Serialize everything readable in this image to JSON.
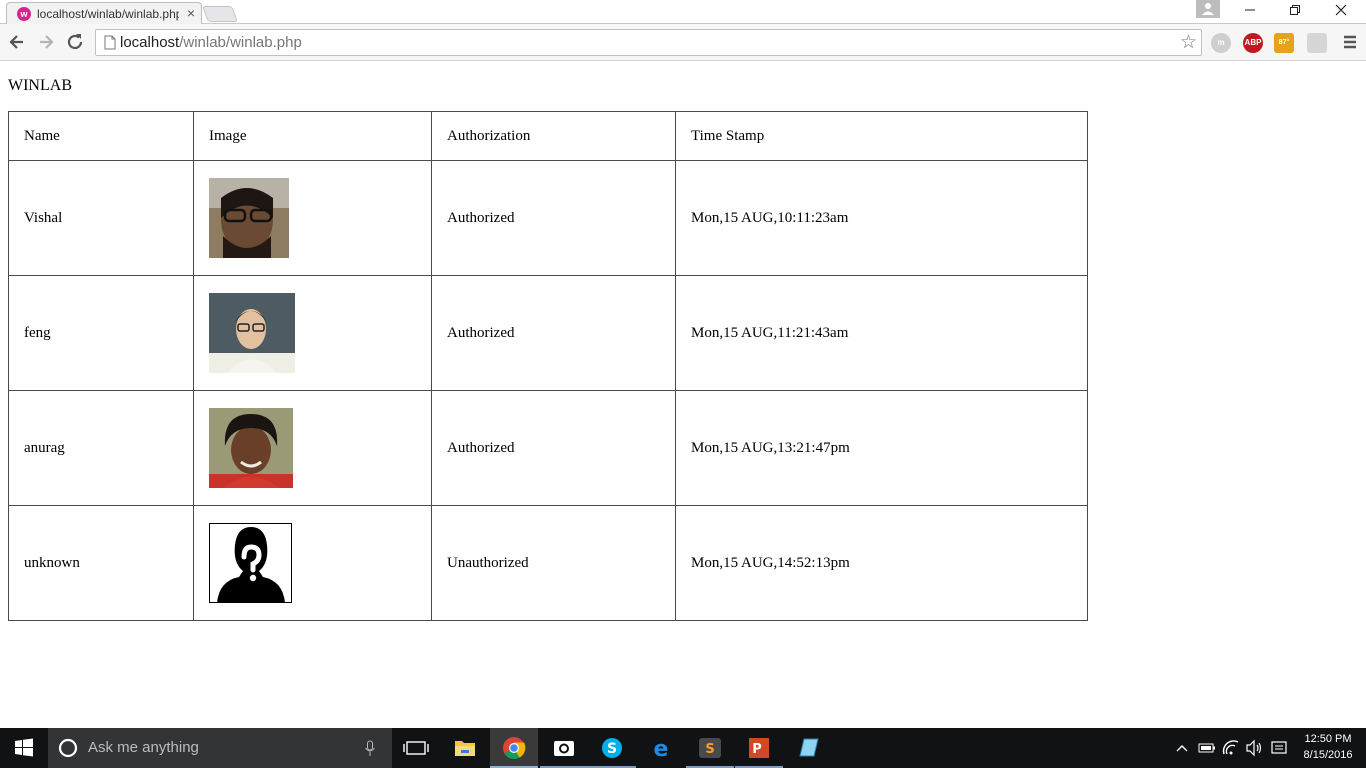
{
  "browser": {
    "tab_title": "localhost/winlab/winlab.php",
    "tab_close": "×",
    "favicon_letter": "w",
    "url_host": "localhost",
    "url_path": "/winlab/winlab.php",
    "extensions": {
      "meta": "m",
      "abp": "ABP",
      "weather": "87°"
    }
  },
  "page": {
    "heading": "WINLAB",
    "table": {
      "headers": {
        "name": "Name",
        "image": "Image",
        "authorization": "Authorization",
        "timestamp": "Time Stamp"
      },
      "rows": [
        {
          "name": "Vishal",
          "authorization": "Authorized",
          "timestamp": "Mon,15 AUG,10:11:23am"
        },
        {
          "name": "feng",
          "authorization": "Authorized",
          "timestamp": "Mon,15 AUG,11:21:43am"
        },
        {
          "name": "anurag",
          "authorization": "Authorized",
          "timestamp": "Mon,15 AUG,13:21:47pm"
        },
        {
          "name": "unknown",
          "authorization": "Unauthorized",
          "timestamp": "Mon,15 AUG,14:52:13pm"
        }
      ]
    }
  },
  "taskbar": {
    "search_placeholder": "Ask me anything",
    "time": "12:50 PM",
    "date": "8/15/2016"
  },
  "colors": {
    "accent_tab": "#d6248f",
    "abp_red": "#c2171e",
    "taskbar": "#111213"
  }
}
